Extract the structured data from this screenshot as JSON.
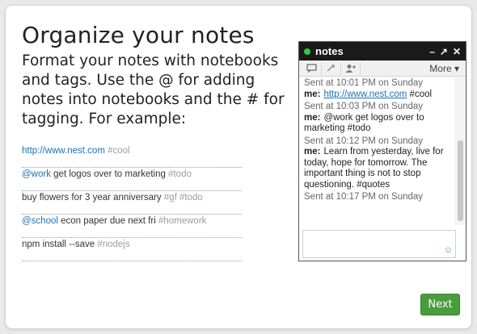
{
  "title": "Organize your notes",
  "description": "Format your notes with notebooks and tags. Use the @ for adding notes into notebooks and the # for tagging. For example:",
  "examples": [
    {
      "parts": [
        {
          "cls": "link",
          "text": "http://www.nest.com"
        },
        {
          "cls": "plain",
          "text": " "
        },
        {
          "cls": "tag",
          "text": "#cool"
        }
      ]
    },
    {
      "parts": [
        {
          "cls": "at",
          "text": "@work"
        },
        {
          "cls": "plain",
          "text": " get logos over to marketing "
        },
        {
          "cls": "tag",
          "text": "#todo"
        }
      ]
    },
    {
      "parts": [
        {
          "cls": "plain",
          "text": "buy flowers for 3 year anniversary "
        },
        {
          "cls": "tag",
          "text": "#gf #todo"
        }
      ]
    },
    {
      "parts": [
        {
          "cls": "at",
          "text": "@school"
        },
        {
          "cls": "plain",
          "text": " econ paper due next fri "
        },
        {
          "cls": "tag",
          "text": "#homework"
        }
      ]
    },
    {
      "parts": [
        {
          "cls": "plain",
          "text": "npm install --save "
        },
        {
          "cls": "tag",
          "text": "#nodejs"
        }
      ]
    }
  ],
  "chat": {
    "title": "notes",
    "controls": {
      "minimize": "–",
      "popout": "↗",
      "close": "✕"
    },
    "more_label": "More ▾",
    "messages": [
      {
        "stamp": "Sent at 10:01 PM on Sunday",
        "sender": "me:",
        "link": "http://www.nest.com",
        "text": " #cool"
      },
      {
        "stamp": "Sent at 10:03 PM on Sunday",
        "sender": "me:",
        "link": "",
        "text": "@work get logos over to marketing #todo"
      },
      {
        "stamp": "Sent at 10:12 PM on Sunday",
        "sender": "me:",
        "link": "",
        "text": "Learn from yesterday, live for today, hope for tomorrow. The important thing is not to stop questioning. #quotes"
      },
      {
        "stamp": "Sent at 10:17 PM on Sunday",
        "sender": "",
        "link": "",
        "text": ""
      }
    ],
    "input_value": ""
  },
  "next_label": "Next",
  "colors": {
    "accent": "#4a9d3e",
    "link": "#1f6fb5",
    "tag": "#9c9c9c",
    "chat_header": "#1a1a1a"
  }
}
